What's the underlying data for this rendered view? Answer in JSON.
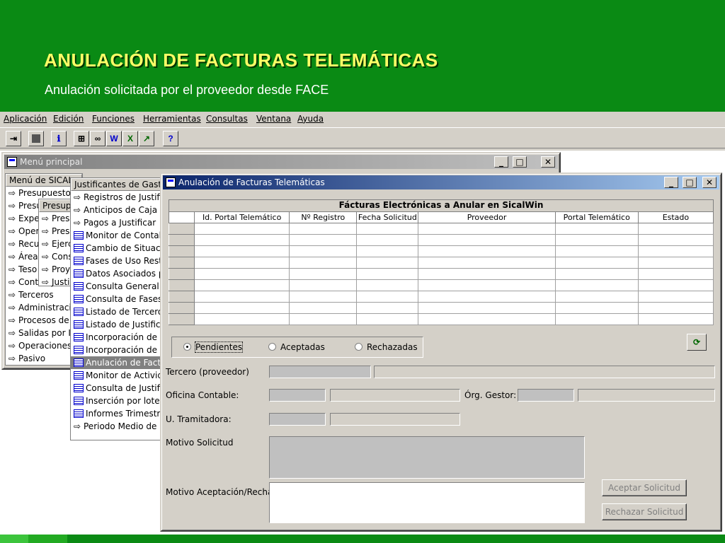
{
  "slide": {
    "title": "ANULACIÓN DE FACTURAS TELEMÁTICAS",
    "subtitle": "Anulación solicitada por el proveedor desde FACE"
  },
  "menubar": [
    "Aplicación",
    "Edición",
    "Funciones",
    "Herramientas",
    "Consultas",
    "Ventana",
    "Ayuda"
  ],
  "toolbar": [
    "exit-icon",
    "stop-icon",
    "info-icon",
    "tree-icon",
    "binoculars-icon",
    "word-icon",
    "excel-icon",
    "chart-icon",
    "help-icon"
  ],
  "menu_window": {
    "title": "Menú principal"
  },
  "sical_panel": {
    "header": "Menú de SICAL",
    "items": [
      "Presupuesto de",
      "Presu",
      "Expe",
      "Oper",
      "Recu",
      "Área-",
      "Teso",
      "Conta",
      "Terceros",
      "Administración",
      "Procesos de A",
      "Salidas por Imp",
      "Operaciones d",
      "Pasivo"
    ]
  },
  "presup_panel": {
    "header": "Presupu",
    "items": [
      "Pres",
      "Pres",
      "Ejerc",
      "Cons",
      "Proye",
      "Justi"
    ]
  },
  "justif_panel": {
    "header": "Justificantes de Gastos",
    "items": [
      {
        "label": "Registros de Justifican",
        "type": "arrow"
      },
      {
        "label": "Anticipos de Caja Fija",
        "type": "arrow"
      },
      {
        "label": "Pagos a Justificar",
        "type": "arrow"
      },
      {
        "label": "Monitor de Contabilizac",
        "type": "grid"
      },
      {
        "label": "Cambio de Situación d",
        "type": "grid"
      },
      {
        "label": "Fases de Uso Restring",
        "type": "grid"
      },
      {
        "label": "Datos Asociados por D",
        "type": "grid"
      },
      {
        "label": "Consulta General de J",
        "type": "grid"
      },
      {
        "label": "Consulta de Fases de",
        "type": "grid"
      },
      {
        "label": "Listado de Terceros po",
        "type": "grid"
      },
      {
        "label": "Listado de Justificante",
        "type": "grid"
      },
      {
        "label": "Incorporación de Factu",
        "type": "grid"
      },
      {
        "label": "Incorporación de Factu",
        "type": "grid"
      },
      {
        "label": "Anulación de Facturas",
        "type": "grid",
        "selected": true
      },
      {
        "label": "Monitor de Actividad A",
        "type": "grid"
      },
      {
        "label": "Consulta de Justificant",
        "type": "grid"
      },
      {
        "label": "Inserción por lotes de",
        "type": "grid"
      },
      {
        "label": "Informes Trimestrales L",
        "type": "grid"
      },
      {
        "label": "Periodo Medio de Pag",
        "type": "arrow"
      }
    ]
  },
  "anul_window": {
    "title": "Anulación de Facturas Telemáticas",
    "grid_caption": "Fácturas Electrónicas a Anular en SicalWin",
    "columns": [
      "Id. Portal Telemático",
      "Nº Registro",
      "Fecha Solicitud",
      "Proveedor",
      "Portal Telemático",
      "Estado"
    ],
    "radios": [
      {
        "label": "Pendientes",
        "checked": true
      },
      {
        "label": "Aceptadas",
        "checked": false
      },
      {
        "label": "Rechazadas",
        "checked": false
      }
    ],
    "labels": {
      "tercero": "Tercero (proveedor)",
      "oficina": "Oficina Contable:",
      "organo": "Órg. Gestor:",
      "unidad": "U. Tramitadora:",
      "motivo": "Motivo Solicitud",
      "motivo_acep": "Motivo Aceptación/Rechazo"
    },
    "buttons": {
      "aceptar": "Aceptar Solicitud",
      "rechazar": "Rechazar Solicitud"
    }
  }
}
